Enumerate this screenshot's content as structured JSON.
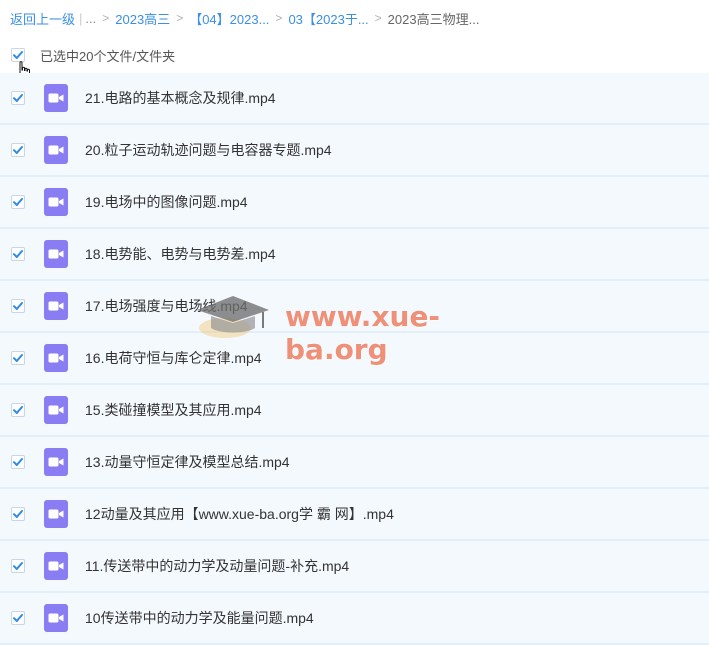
{
  "breadcrumb": {
    "back": "返回上一级",
    "ellipsis": "...",
    "items": [
      "2023高三",
      "【04】2023...",
      "03【2023于...",
      "2023高三物理..."
    ]
  },
  "selection": {
    "label": "已选中20个文件/文件夹",
    "checked": true
  },
  "files": [
    {
      "name": "21.电路的基本概念及规律.mp4",
      "checked": true,
      "icon": "video-file-icon"
    },
    {
      "name": "20.粒子运动轨迹问题与电容器专题.mp4",
      "checked": true,
      "icon": "video-file-icon"
    },
    {
      "name": "19.电场中的图像问题.mp4",
      "checked": true,
      "icon": "video-file-icon"
    },
    {
      "name": "18.电势能、电势与电势差.mp4",
      "checked": true,
      "icon": "video-file-icon"
    },
    {
      "name": "17.电场强度与电场线.mp4",
      "checked": true,
      "icon": "video-file-icon"
    },
    {
      "name": "16.电荷守恒与库仑定律.mp4",
      "checked": true,
      "icon": "video-file-icon"
    },
    {
      "name": "15.类碰撞模型及其应用.mp4",
      "checked": true,
      "icon": "video-file-icon"
    },
    {
      "name": "13.动量守恒定律及模型总结.mp4",
      "checked": true,
      "icon": "video-file-icon"
    },
    {
      "name": "12动量及其应用【www.xue-ba.org学 霸 网】.mp4",
      "checked": true,
      "icon": "video-file-icon"
    },
    {
      "name": "11.传送带中的动力学及动量问题-补充.mp4",
      "checked": true,
      "icon": "video-file-icon"
    },
    {
      "name": "10传送带中的动力学及能量问题.mp4",
      "checked": true,
      "icon": "video-file-icon"
    }
  ],
  "watermark": {
    "text": "www.xue-ba.org"
  },
  "colors": {
    "link": "#3b8fe6",
    "check": "#2e8be6",
    "video_icon": "#8a7cf3",
    "row_bg": "#f4f9fe",
    "watermark": "#ec785a"
  }
}
